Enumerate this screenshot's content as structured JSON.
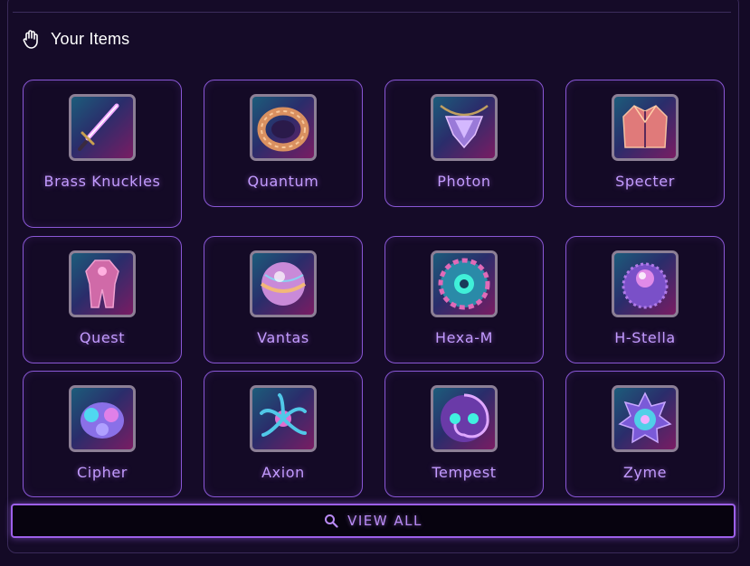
{
  "header": {
    "title": "Your Items",
    "icon": "hand-icon"
  },
  "items": [
    {
      "name": "Brass Knuckles",
      "icon": "sword-icon"
    },
    {
      "name": "Quantum",
      "icon": "ring-icon"
    },
    {
      "name": "Photon",
      "icon": "amulet-icon"
    },
    {
      "name": "Specter",
      "icon": "jacket-icon"
    },
    {
      "name": "Quest",
      "icon": "armor-suit-icon"
    },
    {
      "name": "Vantas",
      "icon": "orb-icon"
    },
    {
      "name": "Hexa-M",
      "icon": "spiral-disc-icon"
    },
    {
      "name": "H-Stella",
      "icon": "spiked-orb-icon"
    },
    {
      "name": "Cipher",
      "icon": "blob-creature-icon"
    },
    {
      "name": "Axion",
      "icon": "tentacle-creature-icon"
    },
    {
      "name": "Tempest",
      "icon": "vortex-icon"
    },
    {
      "name": "Zyme",
      "icon": "star-core-icon"
    }
  ],
  "view_all": {
    "label": "VIEW ALL",
    "icon": "search-icon"
  },
  "colors": {
    "background": "#140a26",
    "accent": "#9d60ea",
    "label": "#c39bff"
  }
}
